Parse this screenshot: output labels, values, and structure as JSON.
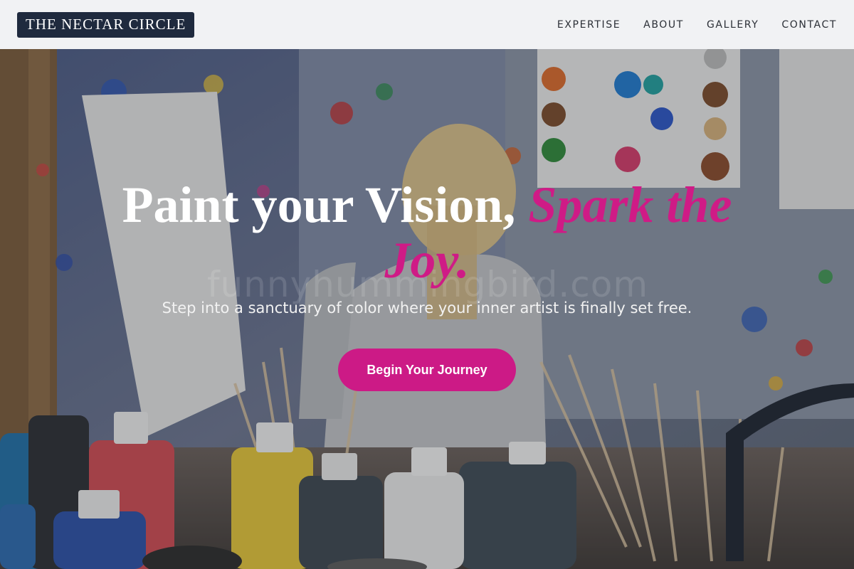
{
  "header": {
    "logo": "THE NECTAR CIRCLE",
    "nav": [
      "EXPERTISE",
      "ABOUT",
      "GALLERY",
      "CONTACT"
    ]
  },
  "hero": {
    "headline_main": "Paint your Vision, ",
    "headline_accent": "Spark the Joy.",
    "subtitle": "Step into a sanctuary of color where your inner artist is finally set free.",
    "cta_label": "Begin Your Journey",
    "watermark": "funnyhummingbird.com"
  },
  "colors": {
    "accent": "#cc1a86",
    "logo_bg": "#1f2a3e",
    "header_bg": "#f1f2f4"
  },
  "icons": [
    "hero-background-image"
  ]
}
